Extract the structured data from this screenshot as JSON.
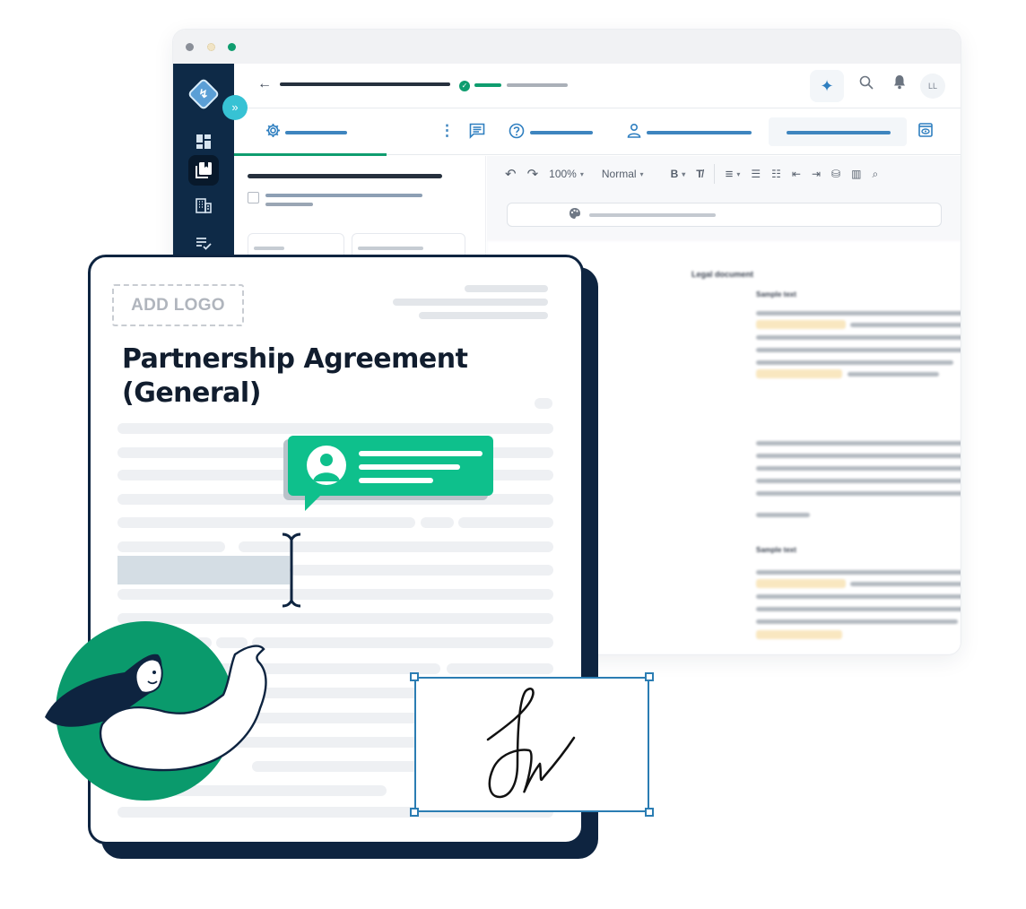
{
  "app": {
    "window_controls": [
      "close",
      "minimize",
      "maximize"
    ],
    "sidebar": {
      "logo": "company-logo",
      "expand_label": "»",
      "items": [
        {
          "name": "dashboard",
          "icon": "dashboard-icon",
          "glyph": "▦"
        },
        {
          "name": "documents",
          "icon": "documents-icon",
          "glyph": "❐",
          "active": true
        },
        {
          "name": "companies",
          "icon": "building-icon",
          "glyph": "▤"
        },
        {
          "name": "tasks",
          "icon": "checklist-icon",
          "glyph": "☰"
        }
      ]
    },
    "topbar": {
      "back_glyph": "←",
      "status_check": "✓",
      "ai_glyph": "✦",
      "search_glyph": "⌕",
      "bell_glyph": "🔔",
      "avatar_initials": "LL"
    },
    "tabs": [
      {
        "name": "settings",
        "icon": "gear-icon",
        "glyph": "⚙"
      },
      {
        "name": "more",
        "icon": "kebab-menu-icon",
        "glyph": "⋮"
      },
      {
        "name": "comments",
        "icon": "comment-icon",
        "glyph": "▤"
      },
      {
        "name": "help",
        "icon": "help-icon",
        "glyph": "?"
      },
      {
        "name": "signers",
        "icon": "user-icon",
        "glyph": "👤"
      },
      {
        "name": "action",
        "icon": "",
        "glyph": ""
      },
      {
        "name": "preview",
        "icon": "eye-icon",
        "glyph": "◉"
      }
    ],
    "toolbar": {
      "undo": "↶",
      "redo": "↷",
      "zoom": "100%",
      "style": "Normal",
      "bold": "B",
      "clear_format": "T̸",
      "align": "≡",
      "bullets": "☰",
      "numbered": "☷",
      "outdent": "⇤",
      "indent": "⇥",
      "insert_field": "⛁",
      "table": "▥",
      "find": "⌕",
      "caret": "▾"
    },
    "theme_icon": "🎨",
    "document": {
      "title": "Legal document",
      "headings": [
        "Sample text",
        "Sample text"
      ]
    }
  },
  "card": {
    "add_logo": "ADD LOGO",
    "title": "Partnership Agreement (General)"
  },
  "signature": {
    "label": "signature-field"
  },
  "colors": {
    "navy": "#0e2440",
    "green": "#0ec08c",
    "teal_green": "#0f9d6f",
    "accent_blue": "#2f7fc0",
    "cyan": "#37c2d4",
    "highlight_yellow": "#f9e7c0"
  }
}
